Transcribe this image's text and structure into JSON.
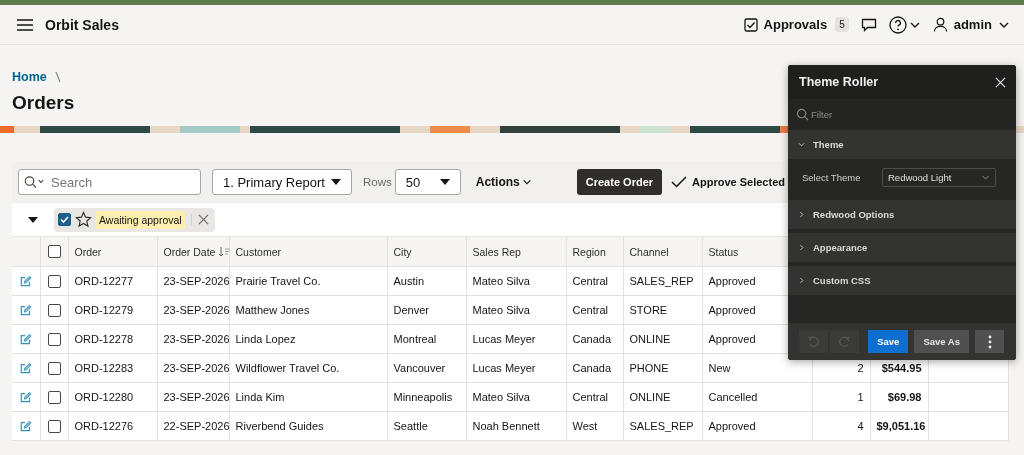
{
  "header": {
    "app_title": "Orbit Sales",
    "approvals": {
      "label": "Approvals",
      "count": "5"
    },
    "user": "admin"
  },
  "breadcrumb": [
    "Home"
  ],
  "page_title": "Orders",
  "report": {
    "search": {
      "placeholder": "Search"
    },
    "report_select": "1. Primary Report",
    "rows_label": "Rows",
    "rows_value": "50",
    "actions": "Actions",
    "create_button": "Create Order",
    "approve_button": "Approve Selected",
    "filter": {
      "expanded": true,
      "checked": true,
      "label": "Awaiting approval"
    },
    "select_all": {
      "checked": false
    },
    "columns": [
      {
        "label": "Order",
        "sorted": false
      },
      {
        "label": "Order Date",
        "sorted": true
      },
      {
        "label": "Customer",
        "sorted": false
      },
      {
        "label": "City",
        "sorted": false
      },
      {
        "label": "Sales Rep",
        "sorted": false
      },
      {
        "label": "Region",
        "sorted": false
      },
      {
        "label": "Channel",
        "sorted": false
      },
      {
        "label": "Status",
        "sorted": false
      }
    ],
    "rows": [
      {
        "checked": false,
        "cells": [
          "ORD-12277",
          "23-SEP-2026",
          "Prairie Travel Co.",
          "Austin",
          "Mateo Silva",
          "Central",
          "SALES_REP",
          "Approved"
        ]
      },
      {
        "checked": false,
        "cells": [
          "ORD-12279",
          "23-SEP-2026",
          "Matthew Jones",
          "Denver",
          "Mateo Silva",
          "Central",
          "STORE",
          "Approved"
        ]
      },
      {
        "checked": false,
        "cells": [
          "ORD-12278",
          "23-SEP-2026",
          "Linda Lopez",
          "Montreal",
          "Lucas Meyer",
          "Canada",
          "ONLINE",
          "Approved"
        ]
      },
      {
        "checked": false,
        "cells": [
          "ORD-12283",
          "23-SEP-2026",
          "Wildflower Travel Co.",
          "Vancouver",
          "Lucas Meyer",
          "Canada",
          "PHONE",
          "New"
        ],
        "column_9": "2",
        "column_10": "$544.95"
      },
      {
        "checked": false,
        "cells": [
          "ORD-12280",
          "23-SEP-2026",
          "Linda Kim",
          "Minneapolis",
          "Mateo Silva",
          "Central",
          "ONLINE",
          "Cancelled"
        ],
        "column_9": "1",
        "column_10": "$69.98"
      },
      {
        "checked": false,
        "cells": [
          "ORD-12276",
          "22-SEP-2026",
          "Riverbend Guides",
          "Seattle",
          "Noah Bennett",
          "West",
          "SALES_REP",
          "Approved"
        ],
        "column_9": "4",
        "column_10": "$9,051.16"
      }
    ]
  },
  "theme_roller": {
    "title": "Theme Roller",
    "filter": {
      "placeholder": "Filter"
    },
    "sections": [
      {
        "label": "Theme",
        "expanded": true,
        "field": {
          "label": "Select Theme",
          "value": "Redwood Light"
        }
      },
      {
        "label": "Redwood Options",
        "expanded": false
      },
      {
        "label": "Appearance",
        "expanded": false
      },
      {
        "label": "Custom CSS",
        "expanded": false
      }
    ],
    "save_button": "Save",
    "save_as_button": "Save As"
  }
}
